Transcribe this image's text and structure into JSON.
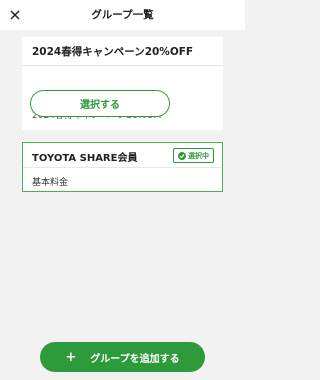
{
  "header": {
    "title": "グループ一覧",
    "close_icon": "close-icon"
  },
  "groups": [
    {
      "title": "2024春得キャンペーン20%OFF",
      "subtitle": "2024春得キャンペーン20%OFF",
      "select_label": "選択する"
    },
    {
      "title": "TOYOTA SHARE会員",
      "badge_label": "選択中",
      "subtitle": "基本料金"
    }
  ],
  "footer": {
    "add_label": "グループを追加する",
    "add_icon": "plus-icon"
  },
  "colors": {
    "accent": "#2e9a3a",
    "background": "#f2f2f2"
  }
}
